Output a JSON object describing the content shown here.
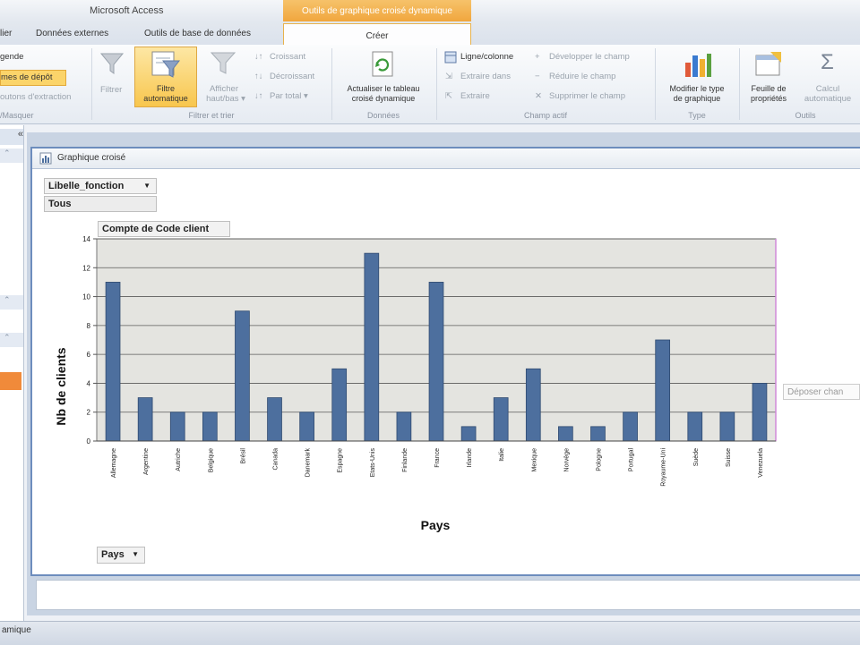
{
  "app": {
    "title": "Microsoft Access",
    "context_title": "Outils de graphique croisé dynamique"
  },
  "tabs": [
    {
      "label": "lier"
    },
    {
      "label": "Données externes"
    },
    {
      "label": "Outils de base de données"
    },
    {
      "label": "Créer"
    }
  ],
  "ribbon": {
    "left_group": {
      "items": [
        "gende",
        "mes de dépôt",
        "outons d'extraction"
      ],
      "label": "/Masquer"
    },
    "filter_group": {
      "label": "Filtrer et trier",
      "filtrer": "Filtrer",
      "filtre_auto_1": "Filtre",
      "filtre_auto_2": "automatique",
      "afficher_1": "Afficher",
      "afficher_2": "haut/bas ▾",
      "croissant": "Croissant",
      "decroissant": "Décroissant",
      "par_total": "Par total ▾"
    },
    "data_group": {
      "label": "Données",
      "actualiser_1": "Actualiser le tableau",
      "actualiser_2": "croisé dynamique"
    },
    "field_group": {
      "label": "Champ actif",
      "ligne_colonne": "Ligne/colonne",
      "extraire_dans": "Extraire dans",
      "extraire": "Extraire",
      "developper": "Développer le champ",
      "reduire": "Réduire le champ",
      "supprimer": "Supprimer le champ"
    },
    "type_group": {
      "label": "Type",
      "modifier_1": "Modifier le type",
      "modifier_2": "de graphique"
    },
    "tools_group": {
      "label": "Outils",
      "feuille_1": "Feuille de",
      "feuille_2": "propriétés",
      "calcul_1": "Calcul",
      "calcul_2": "automatique"
    }
  },
  "nav": {
    "collapse_symbol": "«"
  },
  "document": {
    "title": "Graphique croisé"
  },
  "filter_field": {
    "name": "Libelle_fonction",
    "value": "Tous"
  },
  "data_field": {
    "name": "Compte de Code client"
  },
  "category_field": {
    "name": "Pays"
  },
  "drop_zone": {
    "text": "Déposer chan"
  },
  "status": {
    "text": "amique"
  },
  "chart_data": {
    "type": "bar",
    "title": "",
    "xlabel": "Pays",
    "ylabel": "Nb de clients",
    "ylim": [
      0,
      14
    ],
    "yticks": [
      0,
      2,
      4,
      6,
      8,
      10,
      12,
      14
    ],
    "grid": true,
    "bar_color": "#4d6f9e",
    "plot_bg": "#e4e4e0",
    "categories": [
      "Allemagne",
      "Argentine",
      "Autriche",
      "Belgique",
      "Brésil",
      "Canada",
      "Danemark",
      "Espagne",
      "Etats-Unis",
      "Finlande",
      "France",
      "Irlande",
      "Italie",
      "Mexique",
      "Norvège",
      "Pologne",
      "Portugal",
      "Royaume-Uni",
      "Suède",
      "Suisse",
      "Venezuela"
    ],
    "values": [
      11,
      3,
      2,
      2,
      9,
      3,
      2,
      5,
      13,
      2,
      11,
      1,
      3,
      5,
      1,
      1,
      2,
      7,
      2,
      2,
      4
    ]
  }
}
